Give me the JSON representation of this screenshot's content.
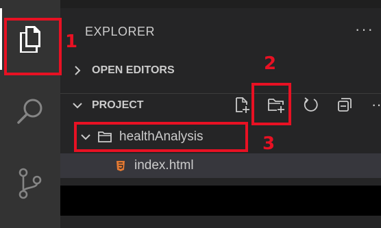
{
  "activity_bar": {
    "items": [
      {
        "icon": "files-icon",
        "active": true
      },
      {
        "icon": "search-icon",
        "active": false
      },
      {
        "icon": "source-control-icon",
        "active": false
      }
    ]
  },
  "explorer": {
    "title": "EXPLORER",
    "more_icon": "ellipsis-icon",
    "more_label": "···"
  },
  "sections": {
    "open_editors": {
      "label": "OPEN EDITORS",
      "expanded": false
    },
    "project": {
      "label": "PROJECT",
      "expanded": true,
      "actions": [
        "new-file-icon",
        "new-folder-icon",
        "refresh-icon",
        "collapse-all-icon",
        "ellipsis-icon"
      ],
      "more_label": "···"
    }
  },
  "tree": {
    "folder": {
      "name": "healthAnalysis",
      "expanded": true
    },
    "files": [
      {
        "name": "index.html",
        "icon": "html5-icon",
        "selected": true
      }
    ]
  },
  "annotations": [
    {
      "number": "1",
      "target": "explorer-activity-icon"
    },
    {
      "number": "2",
      "target": "new-folder-button"
    },
    {
      "number": "3",
      "target": "folder-healthanalysis"
    }
  ],
  "colors": {
    "annotation": "#e81123",
    "activity_bar": "#333333",
    "side_bar": "#252526",
    "selected_row": "#37373d",
    "html_icon": "#e37933"
  }
}
